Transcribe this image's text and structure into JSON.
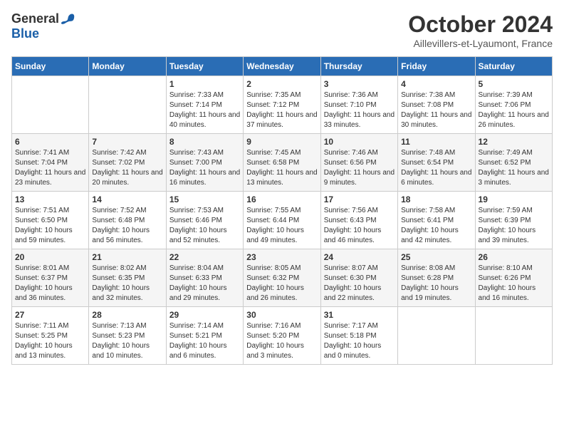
{
  "header": {
    "logo_general": "General",
    "logo_blue": "Blue",
    "title": "October 2024",
    "location": "Aillevillers-et-Lyaumont, France"
  },
  "days_of_week": [
    "Sunday",
    "Monday",
    "Tuesday",
    "Wednesday",
    "Thursday",
    "Friday",
    "Saturday"
  ],
  "weeks": [
    [
      {
        "day": "",
        "info": ""
      },
      {
        "day": "",
        "info": ""
      },
      {
        "day": "1",
        "info": "Sunrise: 7:33 AM\nSunset: 7:14 PM\nDaylight: 11 hours and 40 minutes."
      },
      {
        "day": "2",
        "info": "Sunrise: 7:35 AM\nSunset: 7:12 PM\nDaylight: 11 hours and 37 minutes."
      },
      {
        "day": "3",
        "info": "Sunrise: 7:36 AM\nSunset: 7:10 PM\nDaylight: 11 hours and 33 minutes."
      },
      {
        "day": "4",
        "info": "Sunrise: 7:38 AM\nSunset: 7:08 PM\nDaylight: 11 hours and 30 minutes."
      },
      {
        "day": "5",
        "info": "Sunrise: 7:39 AM\nSunset: 7:06 PM\nDaylight: 11 hours and 26 minutes."
      }
    ],
    [
      {
        "day": "6",
        "info": "Sunrise: 7:41 AM\nSunset: 7:04 PM\nDaylight: 11 hours and 23 minutes."
      },
      {
        "day": "7",
        "info": "Sunrise: 7:42 AM\nSunset: 7:02 PM\nDaylight: 11 hours and 20 minutes."
      },
      {
        "day": "8",
        "info": "Sunrise: 7:43 AM\nSunset: 7:00 PM\nDaylight: 11 hours and 16 minutes."
      },
      {
        "day": "9",
        "info": "Sunrise: 7:45 AM\nSunset: 6:58 PM\nDaylight: 11 hours and 13 minutes."
      },
      {
        "day": "10",
        "info": "Sunrise: 7:46 AM\nSunset: 6:56 PM\nDaylight: 11 hours and 9 minutes."
      },
      {
        "day": "11",
        "info": "Sunrise: 7:48 AM\nSunset: 6:54 PM\nDaylight: 11 hours and 6 minutes."
      },
      {
        "day": "12",
        "info": "Sunrise: 7:49 AM\nSunset: 6:52 PM\nDaylight: 11 hours and 3 minutes."
      }
    ],
    [
      {
        "day": "13",
        "info": "Sunrise: 7:51 AM\nSunset: 6:50 PM\nDaylight: 10 hours and 59 minutes."
      },
      {
        "day": "14",
        "info": "Sunrise: 7:52 AM\nSunset: 6:48 PM\nDaylight: 10 hours and 56 minutes."
      },
      {
        "day": "15",
        "info": "Sunrise: 7:53 AM\nSunset: 6:46 PM\nDaylight: 10 hours and 52 minutes."
      },
      {
        "day": "16",
        "info": "Sunrise: 7:55 AM\nSunset: 6:44 PM\nDaylight: 10 hours and 49 minutes."
      },
      {
        "day": "17",
        "info": "Sunrise: 7:56 AM\nSunset: 6:43 PM\nDaylight: 10 hours and 46 minutes."
      },
      {
        "day": "18",
        "info": "Sunrise: 7:58 AM\nSunset: 6:41 PM\nDaylight: 10 hours and 42 minutes."
      },
      {
        "day": "19",
        "info": "Sunrise: 7:59 AM\nSunset: 6:39 PM\nDaylight: 10 hours and 39 minutes."
      }
    ],
    [
      {
        "day": "20",
        "info": "Sunrise: 8:01 AM\nSunset: 6:37 PM\nDaylight: 10 hours and 36 minutes."
      },
      {
        "day": "21",
        "info": "Sunrise: 8:02 AM\nSunset: 6:35 PM\nDaylight: 10 hours and 32 minutes."
      },
      {
        "day": "22",
        "info": "Sunrise: 8:04 AM\nSunset: 6:33 PM\nDaylight: 10 hours and 29 minutes."
      },
      {
        "day": "23",
        "info": "Sunrise: 8:05 AM\nSunset: 6:32 PM\nDaylight: 10 hours and 26 minutes."
      },
      {
        "day": "24",
        "info": "Sunrise: 8:07 AM\nSunset: 6:30 PM\nDaylight: 10 hours and 22 minutes."
      },
      {
        "day": "25",
        "info": "Sunrise: 8:08 AM\nSunset: 6:28 PM\nDaylight: 10 hours and 19 minutes."
      },
      {
        "day": "26",
        "info": "Sunrise: 8:10 AM\nSunset: 6:26 PM\nDaylight: 10 hours and 16 minutes."
      }
    ],
    [
      {
        "day": "27",
        "info": "Sunrise: 7:11 AM\nSunset: 5:25 PM\nDaylight: 10 hours and 13 minutes."
      },
      {
        "day": "28",
        "info": "Sunrise: 7:13 AM\nSunset: 5:23 PM\nDaylight: 10 hours and 10 minutes."
      },
      {
        "day": "29",
        "info": "Sunrise: 7:14 AM\nSunset: 5:21 PM\nDaylight: 10 hours and 6 minutes."
      },
      {
        "day": "30",
        "info": "Sunrise: 7:16 AM\nSunset: 5:20 PM\nDaylight: 10 hours and 3 minutes."
      },
      {
        "day": "31",
        "info": "Sunrise: 7:17 AM\nSunset: 5:18 PM\nDaylight: 10 hours and 0 minutes."
      },
      {
        "day": "",
        "info": ""
      },
      {
        "day": "",
        "info": ""
      }
    ]
  ]
}
